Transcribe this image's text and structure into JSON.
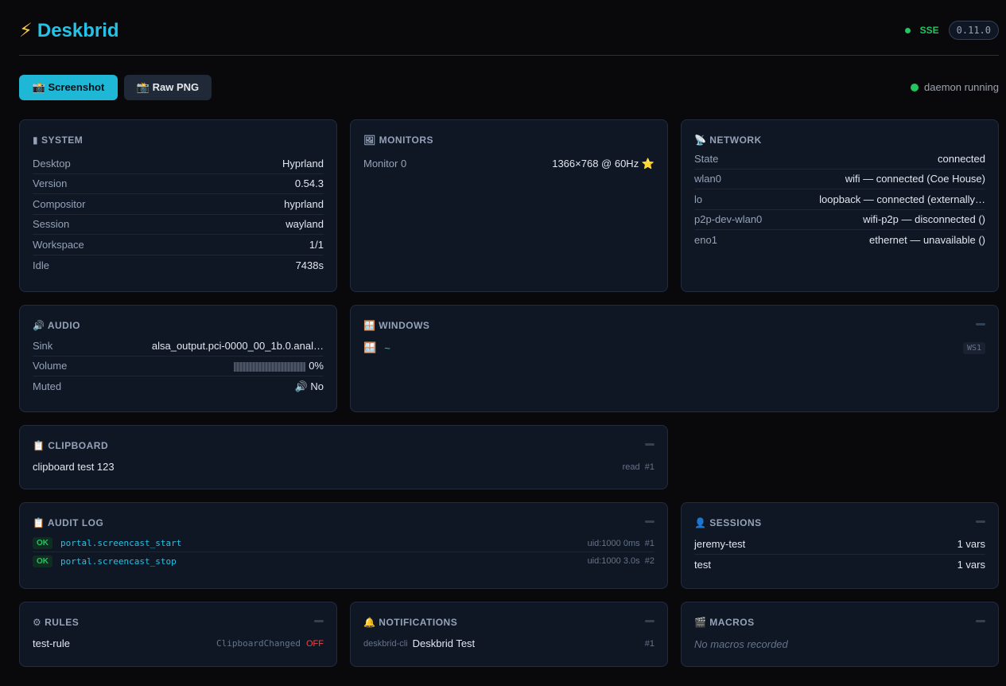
{
  "app": {
    "icon": "⚡",
    "title": "Deskbrid",
    "sse_label": "SSE",
    "version": "0.11.0",
    "daemon_status": "daemon running",
    "accent_color": "#22c3e6",
    "status_color": "#22c55e"
  },
  "toolbar": {
    "screenshot_label": "📸 Screenshot",
    "raw_png_label": "📸 Raw PNG"
  },
  "system": {
    "title": "▮ SYSTEM",
    "rows": [
      {
        "k": "Desktop",
        "v": "Hyprland"
      },
      {
        "k": "Version",
        "v": "0.54.3"
      },
      {
        "k": "Compositor",
        "v": "hyprland"
      },
      {
        "k": "Session",
        "v": "wayland"
      },
      {
        "k": "Workspace",
        "v": "1/1"
      },
      {
        "k": "Idle",
        "v": "7438s"
      }
    ]
  },
  "monitors": {
    "title": "🖼 MONITORS",
    "rows": [
      {
        "k": "Monitor 0",
        "v": "1366×768 @ 60Hz ⭐"
      }
    ]
  },
  "network": {
    "title": "📡 NETWORK",
    "rows": [
      {
        "k": "State",
        "v": "connected"
      },
      {
        "k": "wlan0",
        "v": "wifi — connected (Coe House)"
      },
      {
        "k": "lo",
        "v": "loopback — connected (externally…"
      },
      {
        "k": "p2p-dev-wlan0",
        "v": "wifi-p2p — disconnected ()"
      },
      {
        "k": "eno1",
        "v": "ethernet — unavailable ()"
      }
    ]
  },
  "audio": {
    "title": "🔊 AUDIO",
    "sink_label": "Sink",
    "sink_value": "alsa_output.pci-0000_00_1b.0.anal…",
    "volume_label": "Volume",
    "volume_value": "0%",
    "muted_label": "Muted",
    "muted_value": "🔊 No"
  },
  "windows": {
    "title": "🪟 WINDOWS",
    "items": [
      {
        "icon": "🪟",
        "title": "~",
        "workspace": "WS1"
      }
    ]
  },
  "clipboard": {
    "title": "📋 CLIPBOARD",
    "text": "clipboard test 123",
    "mode": "read",
    "index": "#1"
  },
  "audit_log": {
    "title": "📋 AUDIT LOG",
    "entries": [
      {
        "status": "OK",
        "name": "portal.screencast_start",
        "meta": "uid:1000 0ms",
        "index": "#1"
      },
      {
        "status": "OK",
        "name": "portal.screencast_stop",
        "meta": "uid:1000 3.0s",
        "index": "#2"
      }
    ]
  },
  "sessions": {
    "title": "👤 SESSIONS",
    "rows": [
      {
        "k": "jeremy-test",
        "v": "1 vars"
      },
      {
        "k": "test",
        "v": "1 vars"
      }
    ]
  },
  "rules": {
    "title": "⚙ RULES",
    "name": "test-rule",
    "trigger": "ClipboardChanged",
    "status": "OFF"
  },
  "notifications": {
    "title": "🔔 NOTIFICATIONS",
    "app": "deskbrid-cli",
    "summary": "Deskbrid Test",
    "index": "#1"
  },
  "macros": {
    "title": "🎬 MACROS",
    "empty_text": "No macros recorded"
  }
}
